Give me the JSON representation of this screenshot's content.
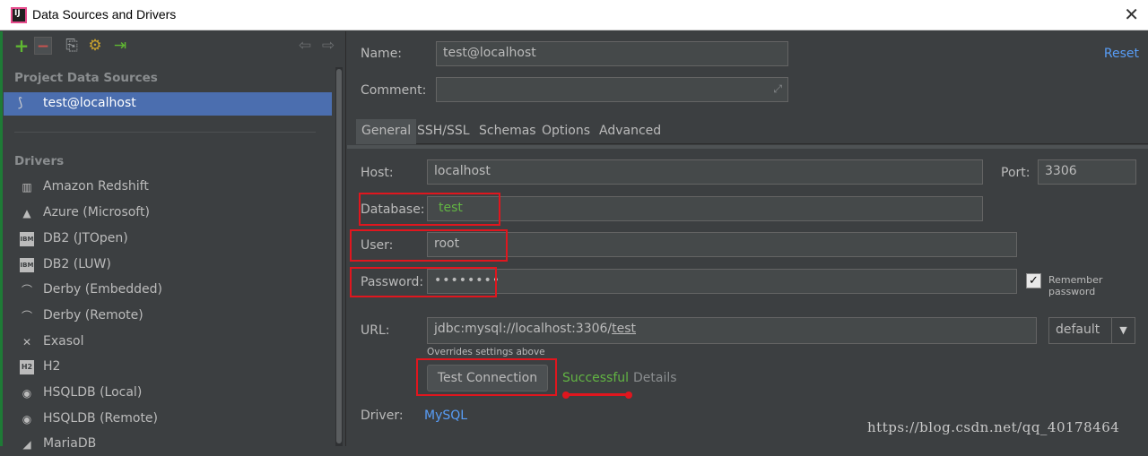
{
  "window": {
    "title": "Data Sources and Drivers",
    "close_glyph": "✕"
  },
  "toolbar": {
    "add": "+",
    "remove": "−",
    "copy": "⎘",
    "properties": "⚙",
    "import": "⇥",
    "back": "⇦",
    "forward": "⇨"
  },
  "sidebar": {
    "project_section": "Project Data Sources",
    "selected_source": "test@localhost",
    "drivers_section": "Drivers",
    "drivers": [
      {
        "label": "Amazon Redshift",
        "icon": "▥"
      },
      {
        "label": "Azure (Microsoft)",
        "icon": "▲"
      },
      {
        "label": "DB2 (JTOpen)",
        "icon": "IBM DB2"
      },
      {
        "label": "DB2 (LUW)",
        "icon": "IBM DB2"
      },
      {
        "label": "Derby (Embedded)",
        "icon": "⌒"
      },
      {
        "label": "Derby (Remote)",
        "icon": "⌒"
      },
      {
        "label": "Exasol",
        "icon": "✕"
      },
      {
        "label": "H2",
        "icon": "H2"
      },
      {
        "label": "HSQLDB (Local)",
        "icon": "◉"
      },
      {
        "label": "HSQLDB (Remote)",
        "icon": "◉"
      },
      {
        "label": "MariaDB",
        "icon": "◢"
      }
    ]
  },
  "form": {
    "name_label": "Name:",
    "name_value": "test@localhost",
    "reset_label": "Reset",
    "comment_label": "Comment:",
    "comment_value": "",
    "expand_glyph": "⤢",
    "tabs": [
      "General",
      "SSH/SSL",
      "Schemas",
      "Options",
      "Advanced"
    ],
    "host_label": "Host:",
    "host_value": "localhost",
    "port_label": "Port:",
    "port_value": "3306",
    "database_label": "Database:",
    "database_value": "test",
    "user_label": "User:",
    "user_value": "root",
    "password_label": "Password:",
    "password_value": "••••••••",
    "remember_label": "Remember password",
    "remember_checked": "✓",
    "url_label": "URL:",
    "url_prefix": "jdbc:mysql://localhost:3306/",
    "url_db": "test",
    "url_mode": "default",
    "url_mode_arrow": "▼",
    "overrides_note": "Overrides settings above",
    "test_button": "Test Connection",
    "test_status": "Successful",
    "details_label": "Details",
    "driver_label": "Driver:",
    "driver_value": "MySQL"
  },
  "watermark": "https://blog.csdn.net/qq_40178464",
  "colors": {
    "selection": "#4b6eaf",
    "link": "#589df6",
    "success": "#62b543",
    "highlight": "#e0161e"
  }
}
